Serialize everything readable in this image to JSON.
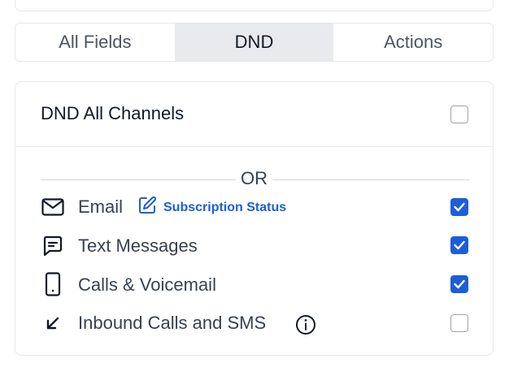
{
  "tabs": [
    {
      "label": "All Fields",
      "active": false
    },
    {
      "label": "DND",
      "active": true
    },
    {
      "label": "Actions",
      "active": false
    }
  ],
  "dnd_all": {
    "label": "DND All Channels",
    "checked": false
  },
  "separator": {
    "label": "OR"
  },
  "channels": [
    {
      "label": "Email",
      "icon": "mail-icon",
      "checked": true
    },
    {
      "label": "Text Messages",
      "icon": "message-icon",
      "checked": true
    },
    {
      "label": "Calls & Voicemail",
      "icon": "phone-icon",
      "checked": true
    },
    {
      "label": "Inbound Calls and SMS",
      "icon": "arrow-down-left-icon",
      "checked": false
    }
  ],
  "subscription_link": {
    "label": "Subscription Status",
    "icon": "edit-icon"
  },
  "colors": {
    "accent": "#1d5ed8",
    "active_tab_bg": "#e9eaee",
    "border": "#e5e7eb"
  }
}
